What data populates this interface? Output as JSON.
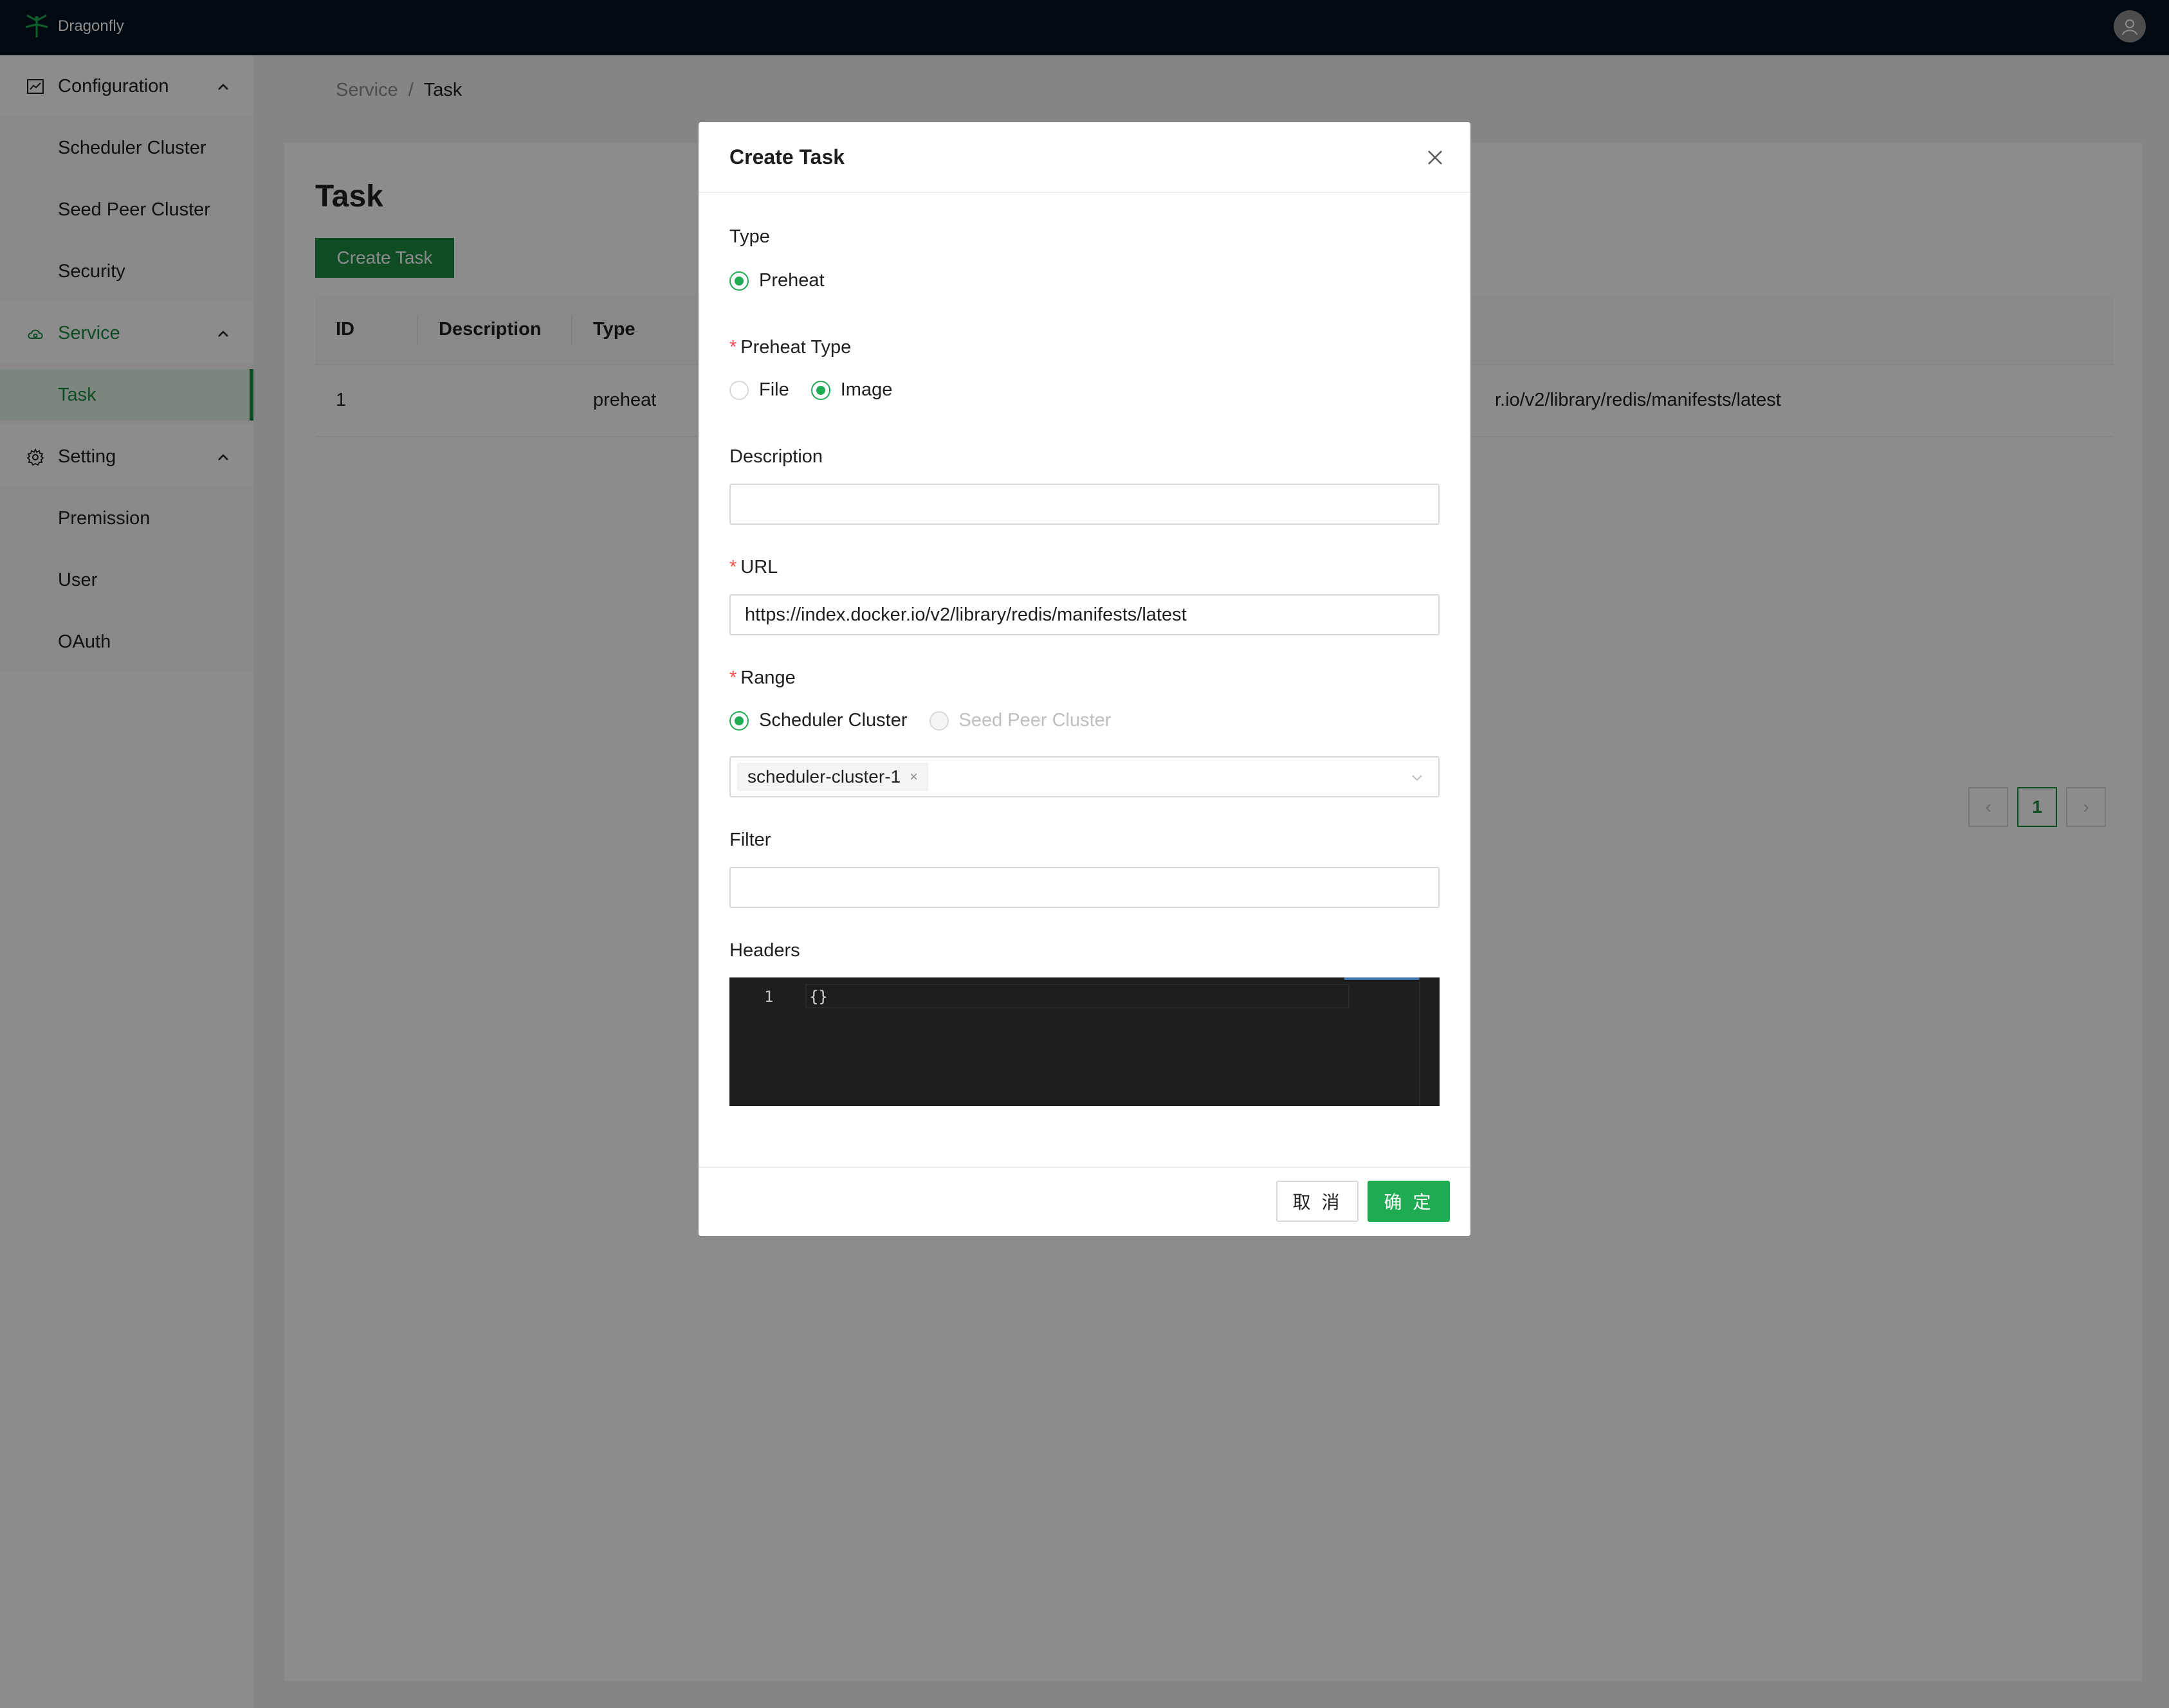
{
  "app": {
    "name": "Dragonfly"
  },
  "colors": {
    "brand": "#1c8b43",
    "accent": "#1fab52",
    "topbar": "#02111f",
    "required": "#ff4d4f"
  },
  "sidebar": {
    "groups": [
      {
        "label": "Configuration",
        "icon": "chart-box-icon",
        "items": [
          {
            "label": "Scheduler Cluster"
          },
          {
            "label": "Seed Peer Cluster"
          },
          {
            "label": "Security"
          }
        ]
      },
      {
        "label": "Service",
        "icon": "cloud-icon",
        "items": [
          {
            "label": "Task"
          }
        ]
      },
      {
        "label": "Setting",
        "icon": "gear-icon",
        "items": [
          {
            "label": "Premission"
          },
          {
            "label": "User"
          },
          {
            "label": "OAuth"
          }
        ]
      }
    ]
  },
  "breadcrumb": {
    "parent": "Service",
    "separator": "/",
    "current": "Task"
  },
  "page": {
    "title": "Task",
    "create_label": "Create Task",
    "table": {
      "columns": [
        "ID",
        "Description",
        "Type"
      ],
      "rows": [
        {
          "id": "1",
          "description": "",
          "type": "preheat",
          "url_fragment": "r.io/v2/library/redis/manifests/latest"
        }
      ]
    },
    "pagination": {
      "prev": "‹",
      "current": "1",
      "next": "›"
    }
  },
  "modal": {
    "title": "Create Task",
    "type": {
      "label": "Type",
      "options": [
        "Preheat"
      ],
      "selected": "Preheat"
    },
    "preheat_type": {
      "label": "Preheat Type",
      "options": [
        "File",
        "Image"
      ],
      "selected": "Image"
    },
    "description": {
      "label": "Description",
      "value": ""
    },
    "url": {
      "label": "URL",
      "value": "https://index.docker.io/v2/library/redis/manifests/latest"
    },
    "range": {
      "label": "Range",
      "options": [
        "Scheduler Cluster",
        "Seed Peer Cluster"
      ],
      "selected": "Scheduler Cluster",
      "tags": [
        "scheduler-cluster-1"
      ],
      "tag_remove": "×"
    },
    "filter": {
      "label": "Filter",
      "value": ""
    },
    "headers": {
      "label": "Headers",
      "line_number": "1",
      "code": "{}"
    },
    "cancel_label": "取 消",
    "ok_label": "确 定"
  }
}
